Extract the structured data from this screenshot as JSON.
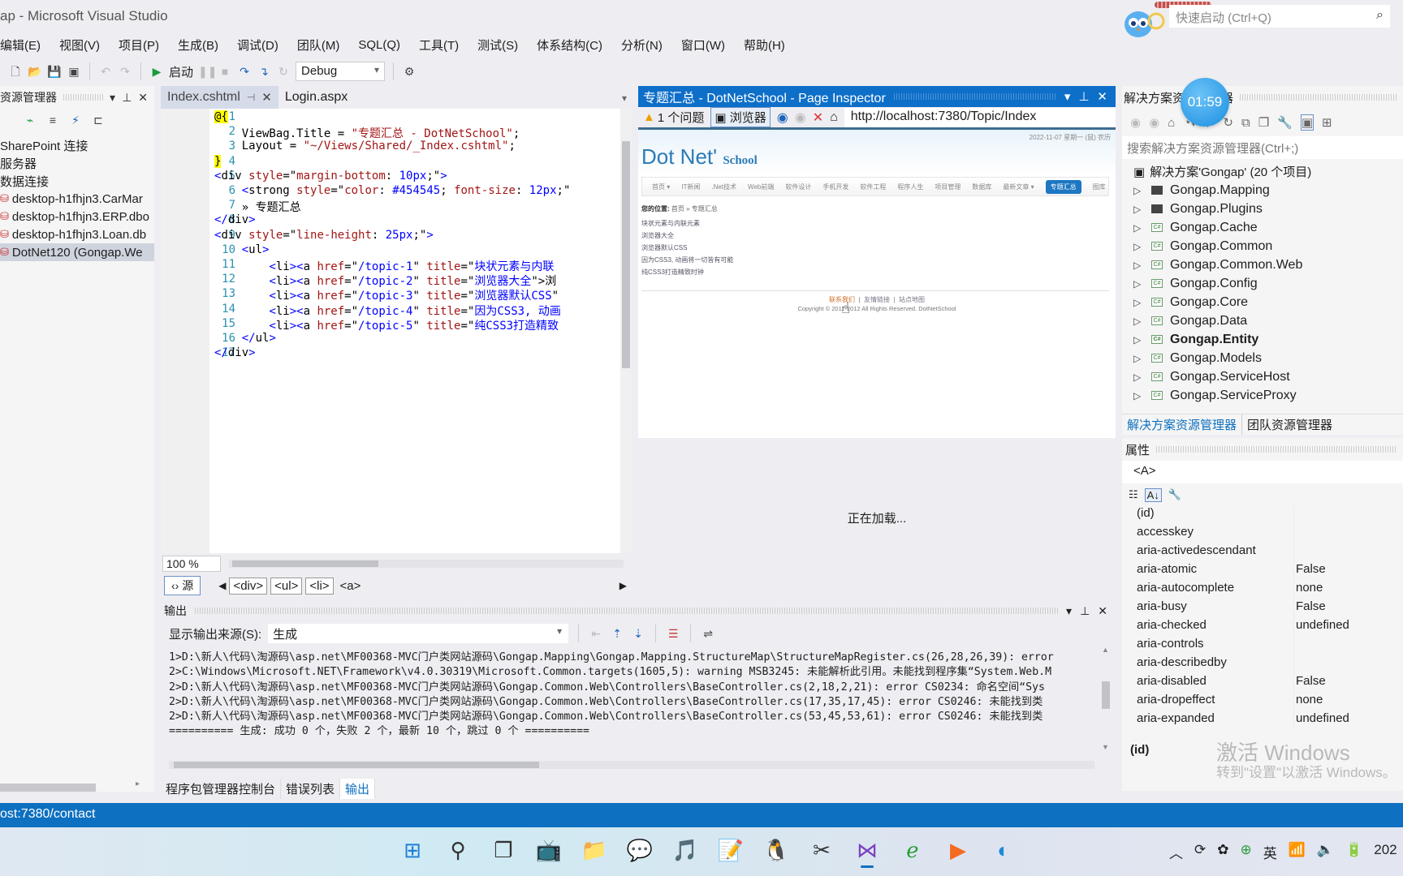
{
  "window": {
    "title": "ap - Microsoft Visual Studio"
  },
  "quick_launch": {
    "placeholder": "快速启动 (Ctrl+Q)"
  },
  "menu": [
    "编辑(E)",
    "视图(V)",
    "项目(P)",
    "生成(B)",
    "调试(D)",
    "团队(M)",
    "SQL(Q)",
    "工具(T)",
    "测试(S)",
    "体系结构(C)",
    "分析(N)",
    "窗口(W)",
    "帮助(H)"
  ],
  "toolbar": {
    "start_label": "启动",
    "config": "Debug"
  },
  "server_explorer": {
    "title": "资源管理器",
    "items": [
      {
        "label": "SharePoint 连接",
        "icon": ""
      },
      {
        "label": "服务器",
        "icon": ""
      },
      {
        "label": "数据连接",
        "icon": ""
      },
      {
        "label": "desktop-h1fhjn3.CarMar",
        "icon": "db-error-icon"
      },
      {
        "label": "desktop-h1fhjn3.ERP.dbo",
        "icon": "db-error-icon"
      },
      {
        "label": "desktop-h1fhjn3.Loan.db",
        "icon": "db-error-icon"
      },
      {
        "label": "DotNet120 (Gongap.We",
        "icon": "db-error-icon",
        "selected": true
      }
    ]
  },
  "editor": {
    "tabs": [
      {
        "label": "Index.cshtml",
        "active": true,
        "pinned": true
      },
      {
        "label": "Login.aspx",
        "active": false
      }
    ],
    "lines": [
      {
        "n": "1",
        "html": "<span class=\"hl\">@{</span>"
      },
      {
        "n": "2",
        "html": "    ViewBag.Title = <span class=\"s\">\"专题汇总 - DotNetSchool\"</span>;"
      },
      {
        "n": "3",
        "html": "    Layout = <span class=\"s\">\"~/Views/Shared/_Index.cshtml\"</span>;"
      },
      {
        "n": "4",
        "html": "<span class=\"hl\">}</span>"
      },
      {
        "n": "5",
        "html": "<span class=\"a\">&lt;</span>div <span class=\"s\">style</span>=\"<span class=\"s\">margin-bottom</span>: <span class=\"a\">10px</span>;\"<span class=\"a\">&gt;</span>"
      },
      {
        "n": "6",
        "html": "    <span class=\"a\">&lt;</span>strong <span class=\"s\">style</span>=\"<span class=\"s\">color</span>: <span class=\"a\">#454545</span>; <span class=\"s\">font-size</span>: <span class=\"a\">12px</span>;\""
      },
      {
        "n": "7",
        "html": "    » 专题汇总"
      },
      {
        "n": "8",
        "html": "<span class=\"a\">&lt;/</span>div<span class=\"a\">&gt;</span>"
      },
      {
        "n": "9",
        "html": "<span class=\"a\">&lt;</span>div <span class=\"s\">style</span>=\"<span class=\"s\">line-height</span>: <span class=\"a\">25px</span>;\"<span class=\"a\">&gt;</span>"
      },
      {
        "n": "10",
        "html": "    <span class=\"a\">&lt;</span>ul<span class=\"a\">&gt;</span>"
      },
      {
        "n": "11",
        "html": "        <span class=\"a\">&lt;</span>li<span class=\"a\">&gt;&lt;</span>a <span class=\"s\">href</span>=\"<span class=\"a\">/topic-1</span>\" <span class=\"s\">title</span>=\"<span class=\"a\">块状元素与内联</span>"
      },
      {
        "n": "12",
        "html": "        <span class=\"a\">&lt;</span>li<span class=\"a\">&gt;&lt;</span>a <span class=\"s\">href</span>=\"<span class=\"a\">/topic-2</span>\" <span class=\"s\">title</span>=\"<span class=\"a\">浏览器大全</span>\"&gt;浏"
      },
      {
        "n": "13",
        "html": "        <span class=\"a\">&lt;</span>li<span class=\"a\">&gt;&lt;</span>a <span class=\"s\">href</span>=\"<span class=\"a\">/topic-3</span>\" <span class=\"s\">title</span>=\"<span class=\"a\">浏览器默认CSS</span>\""
      },
      {
        "n": "14",
        "html": "        <span class=\"a\">&lt;</span>li<span class=\"a\">&gt;&lt;</span>a <span class=\"s\">href</span>=\"<span class=\"a\">/topic-4</span>\" <span class=\"s\">title</span>=\"<span class=\"a\">因为CSS3, 动画</span>"
      },
      {
        "n": "15",
        "html": "        <span class=\"a\">&lt;</span>li<span class=\"a\">&gt;&lt;</span>a <span class=\"s\">href</span>=\"<span class=\"a\">/topic-5</span>\" <span class=\"s\">title</span>=\"<span class=\"a\">纯CSS3打造精致</span>"
      },
      {
        "n": "16",
        "html": "    <span class=\"a\">&lt;/</span>ul<span class=\"a\">&gt;</span>"
      },
      {
        "n": "17",
        "html": "<span class=\"a\">&lt;/</span>div<span class=\"a\">&gt;</span>"
      }
    ],
    "zoom": "100 %",
    "source_btn": "源",
    "breadcrumbs": [
      "<div>",
      "<ul>",
      "<li>",
      "<a>"
    ]
  },
  "inspector": {
    "title": "专题汇总 - DotNetSchool - Page Inspector",
    "issues": "1 个问题",
    "browser_btn": "浏览器",
    "url": "http://localhost:7380/Topic/Index",
    "loading": "正在加载...",
    "page": {
      "date": "2022-11-07 星期一 (鼠) 农历",
      "logo_main": "Dot Net'",
      "logo_sub": "School",
      "nav": [
        "首页 ▾",
        "IT新闻",
        ".Net技术",
        "Web前端",
        "软件设计",
        "手机开发",
        "软件工程",
        "程序人生",
        "项目管理",
        "数据库",
        "最新文章 ▾",
        "专题汇总",
        "图库"
      ],
      "nav_active": "专题汇总",
      "position_label": "您的位置:",
      "position_path": "首页 » 专题汇总",
      "topics": [
        "块状元素与内联元素",
        "浏览器大全",
        "浏览器默认CSS",
        "因为CSS3, 动画将一切皆有可能",
        "纯CSS3打造精致时钟"
      ],
      "footer_links": [
        "联系我们",
        "友情链接",
        "站点地图"
      ],
      "copyright": "Copyright © 2011-2012 All Rights Reserved. DotNetSchool"
    }
  },
  "solution_explorer": {
    "title": "解决方案资源管理器",
    "timer": "01:59",
    "search_placeholder": "搜索解决方案资源管理器(Ctrl+;)",
    "root": "解决方案'Gongap' (20 个项目)",
    "projects": [
      {
        "name": "Gongap.Mapping",
        "type": "folder"
      },
      {
        "name": "Gongap.Plugins",
        "type": "folder"
      },
      {
        "name": "Gongap.Cache",
        "type": "csproj"
      },
      {
        "name": "Gongap.Common",
        "type": "csproj"
      },
      {
        "name": "Gongap.Common.Web",
        "type": "csproj"
      },
      {
        "name": "Gongap.Config",
        "type": "csproj"
      },
      {
        "name": "Gongap.Core",
        "type": "csproj"
      },
      {
        "name": "Gongap.Data",
        "type": "csproj"
      },
      {
        "name": "Gongap.Entity",
        "type": "csproj",
        "bold": true
      },
      {
        "name": "Gongap.Models",
        "type": "csproj"
      },
      {
        "name": "Gongap.ServiceHost",
        "type": "csproj"
      },
      {
        "name": "Gongap.ServiceProxy",
        "type": "csproj"
      }
    ],
    "tabs": [
      "解决方案资源管理器",
      "团队资源管理器"
    ]
  },
  "properties": {
    "title": "属性",
    "element": "<A>",
    "rows": [
      {
        "k": "(id)",
        "v": ""
      },
      {
        "k": "accesskey",
        "v": ""
      },
      {
        "k": "aria-activedescendant",
        "v": ""
      },
      {
        "k": "aria-atomic",
        "v": "False"
      },
      {
        "k": "aria-autocomplete",
        "v": "none"
      },
      {
        "k": "aria-busy",
        "v": "False"
      },
      {
        "k": "aria-checked",
        "v": "undefined"
      },
      {
        "k": "aria-controls",
        "v": ""
      },
      {
        "k": "aria-describedby",
        "v": ""
      },
      {
        "k": "aria-disabled",
        "v": "False"
      },
      {
        "k": "aria-dropeffect",
        "v": "none"
      },
      {
        "k": "aria-expanded",
        "v": "undefined"
      }
    ],
    "description": "(id)",
    "watermark_title": "激活 Windows",
    "watermark_sub": "转到\"设置\"以激活 Windows。"
  },
  "output": {
    "title": "输出",
    "source_label": "显示输出来源(S):",
    "source_value": "生成",
    "lines": [
      "1>D:\\新人\\代码\\淘源码\\asp.net\\MF00368-MVC门户类网站源码\\Gongap.Mapping\\Gongap.Mapping.StructureMap\\StructureMapRegister.cs(26,28,26,39): error",
      "2>C:\\Windows\\Microsoft.NET\\Framework\\v4.0.30319\\Microsoft.Common.targets(1605,5): warning MSB3245: 未能解析此引用。未能找到程序集“System.Web.M",
      "2>D:\\新人\\代码\\淘源码\\asp.net\\MF00368-MVC门户类网站源码\\Gongap.Common.Web\\Controllers\\BaseController.cs(2,18,2,21): error CS0234: 命名空间“Sys",
      "2>D:\\新人\\代码\\淘源码\\asp.net\\MF00368-MVC门户类网站源码\\Gongap.Common.Web\\Controllers\\BaseController.cs(17,35,17,45): error CS0246: 未能找到类",
      "2>D:\\新人\\代码\\淘源码\\asp.net\\MF00368-MVC门户类网站源码\\Gongap.Common.Web\\Controllers\\BaseController.cs(53,45,53,61): error CS0246: 未能找到类",
      "========== 生成: 成功 0 个，失败 2 个，最新 10 个，跳过 0 个 =========="
    ]
  },
  "bottom_tabs": [
    "程序包管理器控制台",
    "错误列表",
    "输出"
  ],
  "bottom_tab_active": "输出",
  "status_bar": {
    "text": "ost:7380/contact"
  },
  "taskbar": {
    "apps": [
      "start-icon",
      "search-icon",
      "task-view-icon",
      "bilibili-icon",
      "file-explorer-icon",
      "wechat-icon",
      "music-icon",
      "notepad-icon",
      "qq-icon",
      "tool-icon",
      "visual-studio-icon",
      "ie-icon",
      "media-icon",
      "edge-icon"
    ],
    "ime": "英",
    "clock_partial": "202"
  },
  "colors": {
    "accent": "#0e70c0",
    "inspector_header": "#0e6fc9"
  }
}
